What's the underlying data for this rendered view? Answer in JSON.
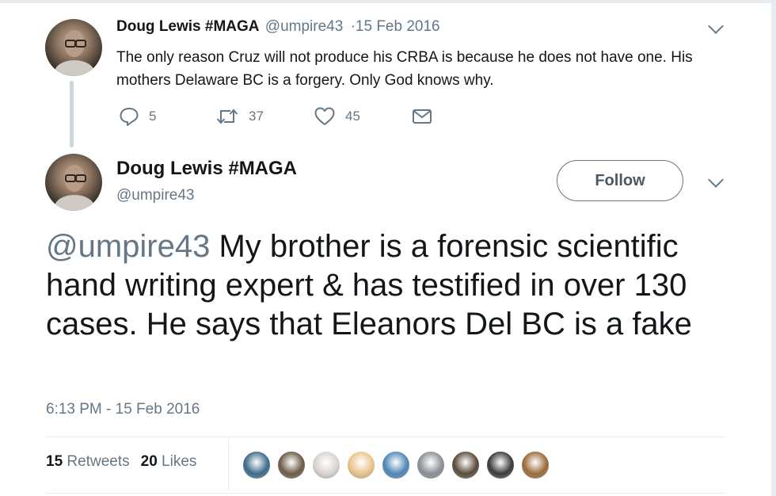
{
  "parent_tweet": {
    "author_name": "Doug Lewis #MAGA",
    "handle": "@umpire43",
    "dot": "·",
    "date": "15 Feb 2016",
    "text": "The only reason Cruz will not produce his CRBA is because he does not have one. His mothers Delaware BC is a forgery. Only God knows why.",
    "replies": "5",
    "retweets": "37",
    "likes": "45"
  },
  "main_tweet": {
    "author_name": "Doug Lewis #MAGA",
    "handle": "@umpire43",
    "follow_label": "Follow",
    "mention": "@umpire43",
    "text": " My brother is a forensic scientific hand writing expert & has testified in over 130 cases. He says that Eleanors Del BC is a fake",
    "timestamp": "6:13 PM - 15 Feb 2016",
    "retweet_count": "15",
    "retweet_label": "Retweets",
    "like_count": "20",
    "like_label": "Likes"
  },
  "icons": {
    "reply": "reply-icon",
    "retweet": "retweet-icon",
    "like": "heart-icon",
    "message": "envelope-icon",
    "more": "chevron-down-icon"
  },
  "colors": {
    "text": "#14171a",
    "secondary": "#657786",
    "divider": "#e6ecf0"
  },
  "likers": [
    {
      "name": "liker-avatar-eye",
      "bg": "#3d6b8a"
    },
    {
      "name": "liker-avatar-man",
      "bg": "#6b5a45"
    },
    {
      "name": "liker-avatar-trump-girl",
      "bg": "#d9d3cf"
    },
    {
      "name": "liker-avatar-cartoon",
      "bg": "#e8c48a"
    },
    {
      "name": "liker-avatar-globe",
      "bg": "#4f86b8"
    },
    {
      "name": "liker-avatar-couple",
      "bg": "#8a8f96"
    },
    {
      "name": "liker-avatar-eagle",
      "bg": "#5a4a3a"
    },
    {
      "name": "liker-avatar-bw",
      "bg": "#3a3a3a"
    },
    {
      "name": "liker-avatar-flag",
      "bg": "#9a6a3a"
    }
  ]
}
